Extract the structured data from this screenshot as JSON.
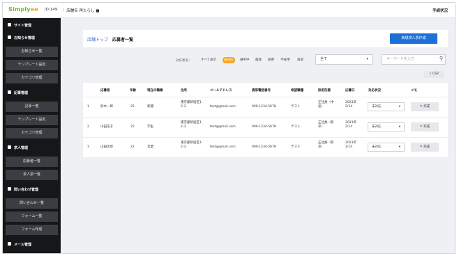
{
  "topbar": {
    "logo_main": "Simply",
    "logo_accent": "ee",
    "id_label": "ID:149",
    "store_label": "｜ 店舗名 再たらし ■",
    "right_label": "手続状況"
  },
  "sidebar": {
    "sections": [
      {
        "label": "サイト管理",
        "items": []
      },
      {
        "label": "お知らせ管理",
        "items": [
          "お知らせ一覧",
          "テンプレート設定",
          "カテゴリ管理"
        ]
      },
      {
        "label": "記事管理",
        "items": [
          "記事一覧",
          "テンプレート設定",
          "カテゴリ管理"
        ]
      },
      {
        "label": "求人管理",
        "items": [
          "応募者一覧",
          "求人票一覧"
        ]
      },
      {
        "label": "問い合わせ管理",
        "items": [
          "問い合わせ一覧",
          "フォーム一覧",
          "フォーム作成"
        ]
      },
      {
        "label": "メール管理",
        "items": []
      }
    ]
  },
  "header": {
    "breadcrumb_link": "店舗トップ",
    "breadcrumb_current": "応募者一覧",
    "new_button": "新規求人票作成"
  },
  "filters": {
    "label": "対応状況：",
    "chips": [
      "すべて表示",
      "未対応",
      "選考中",
      "面接",
      "採用",
      "不採用",
      "辞退"
    ],
    "active_chip": "未対応",
    "select_value": "全て",
    "search_placeholder": "キーワードを入力",
    "csv_label": "CSV"
  },
  "table": {
    "headers": [
      "応募者",
      "年齢",
      "現在の職業",
      "住所",
      "メールアドレス",
      "携帯電話番号",
      "希望職種",
      "採用形態",
      "応募日",
      "対応状況",
      "メモ"
    ],
    "rows": [
      {
        "num": "1",
        "name": "鈴木一郎",
        "age": "25",
        "job": "新聞",
        "address": "東京都新宿区1-2-3",
        "email": "test@gmail.com",
        "phone": "090-1234-5678",
        "desired": "テスト",
        "type": "正社員（中途）",
        "date": "2023年2/14",
        "status": "未対応",
        "memo": "作成"
      },
      {
        "num": "2",
        "name": "山田花子",
        "age": "22",
        "job": "学生",
        "address": "東京都新宿区1-2-3",
        "email": "test@gmail.com",
        "phone": "090-1234-5678",
        "desired": "テスト",
        "type": "正社員（新卒）",
        "date": "2023年2/14",
        "status": "未対応",
        "memo": "作成"
      },
      {
        "num": "3",
        "name": "山田太郎",
        "age": "22",
        "job": "営業",
        "address": "東京都新宿区1-2-3",
        "email": "test@gmail.com",
        "phone": "090-1234-5678",
        "desired": "テスト",
        "type": "正社員（新卒）",
        "date": "2023年2/14",
        "status": "未対応",
        "memo": "作成"
      }
    ]
  },
  "colors": {
    "sidebar_bg": "#151719",
    "sidebar_item": "#3a3d42",
    "primary": "#1f70d6",
    "chip_active": "#f5a623",
    "page_bg": "#eef0f4"
  }
}
